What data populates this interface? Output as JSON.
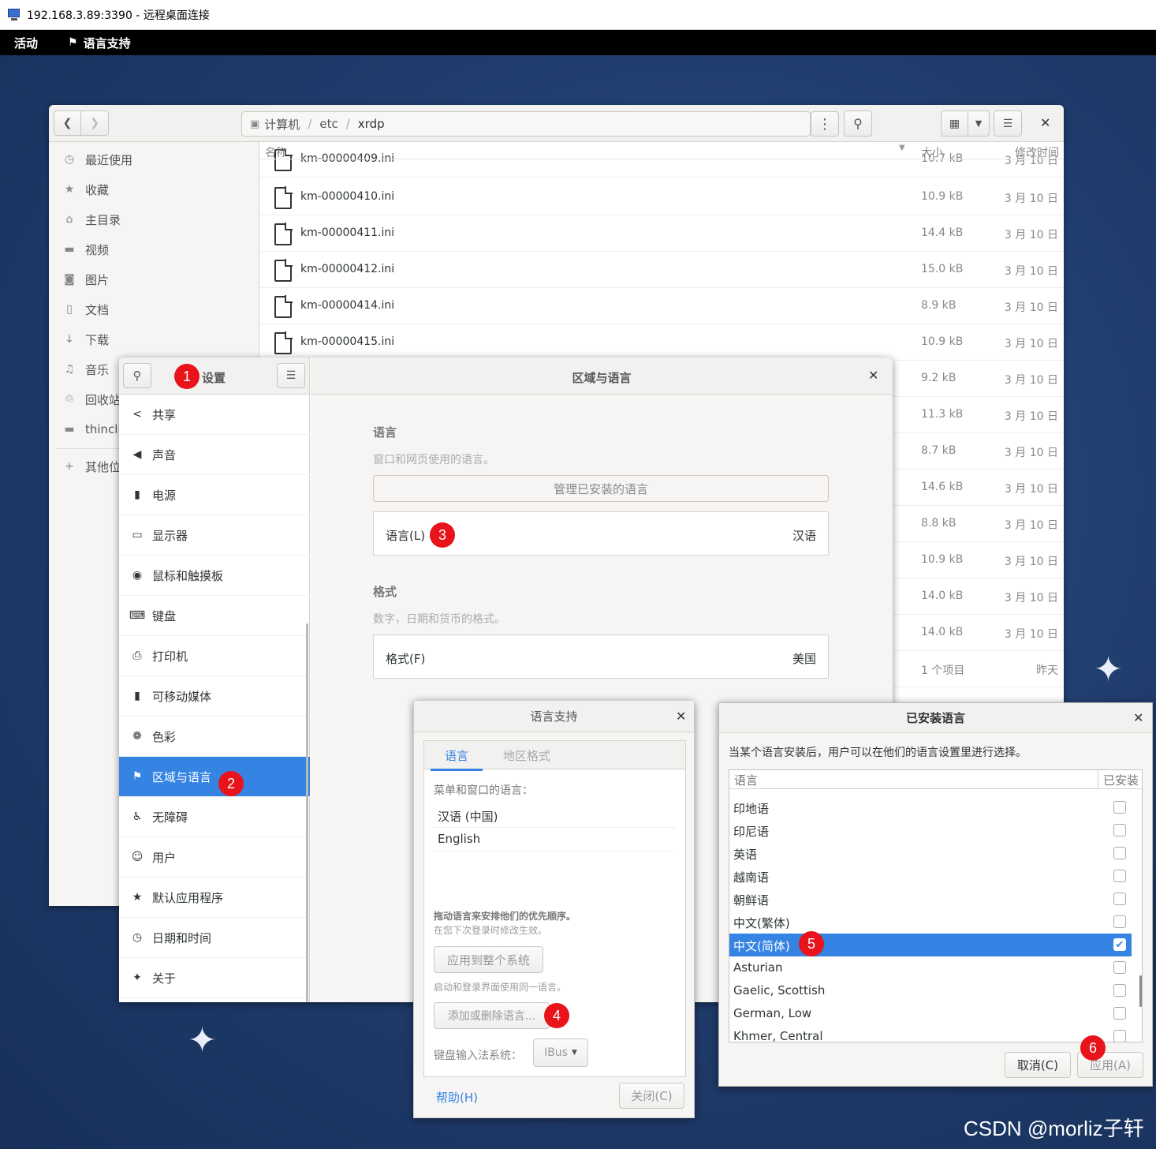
{
  "rdp": {
    "title": "192.168.3.89:3390 - 远程桌面连接"
  },
  "topbar": {
    "activities": "活动",
    "app_name": "语言支持"
  },
  "file_manager": {
    "path": [
      "计算机",
      "etc",
      "xrdp"
    ],
    "sidebar": [
      "最近使用",
      "收藏",
      "主目录",
      "视频",
      "图片",
      "文档",
      "下载",
      "音乐",
      "回收站",
      "thinclie",
      "其他位置"
    ],
    "columns": {
      "name": "名称",
      "size": "大小",
      "modified": "修改时间"
    },
    "rows": [
      {
        "name": "km-00000409.ini",
        "size": "10.7 kB",
        "date": "3 月 10 日"
      },
      {
        "name": "km-00000410.ini",
        "size": "10.9 kB",
        "date": "3 月 10 日"
      },
      {
        "name": "km-00000411.ini",
        "size": "14.4 kB",
        "date": "3 月 10 日"
      },
      {
        "name": "km-00000412.ini",
        "size": "15.0 kB",
        "date": "3 月 10 日"
      },
      {
        "name": "km-00000414.ini",
        "size": "8.9 kB",
        "date": "3 月 10 日"
      },
      {
        "name": "km-00000415.ini",
        "size": "10.9 kB",
        "date": "3 月 10 日"
      },
      {
        "name": "",
        "size": "9.2 kB",
        "date": "3 月 10 日"
      },
      {
        "name": "",
        "size": "11.3 kB",
        "date": "3 月 10 日"
      },
      {
        "name": "",
        "size": "8.7 kB",
        "date": "3 月 10 日"
      },
      {
        "name": "",
        "size": "14.6 kB",
        "date": "3 月 10 日"
      },
      {
        "name": "",
        "size": "8.8 kB",
        "date": "3 月 10 日"
      },
      {
        "name": "",
        "size": "10.9 kB",
        "date": "3 月 10 日"
      },
      {
        "name": "",
        "size": "14.0 kB",
        "date": "3 月 10 日"
      },
      {
        "name": "",
        "size": "14.0 kB",
        "date": "3 月 10 日"
      },
      {
        "name": "",
        "size": "1 个项目",
        "date": "昨天"
      }
    ]
  },
  "settings": {
    "title": "设置",
    "panel_title": "区域与语言",
    "items": [
      "共享",
      "声音",
      "电源",
      "显示器",
      "鼠标和触摸板",
      "键盘",
      "打印机",
      "可移动媒体",
      "色彩",
      "区域与语言",
      "无障碍",
      "用户",
      "默认应用程序",
      "日期和时间",
      "关于"
    ],
    "selected_index": 9,
    "language_header": "语言",
    "language_desc": "窗口和网页使用的语言。",
    "manage_button": "管理已安装的语言",
    "language_label": "语言(L)",
    "language_value": "汉语",
    "format_header": "格式",
    "format_desc": "数字，日期和货币的格式。",
    "format_label": "格式(F)",
    "format_value": "美国"
  },
  "language_support": {
    "title": "语言支持",
    "tabs": [
      "语言",
      "地区格式"
    ],
    "menu_lang_label": "菜单和窗口的语言：",
    "languages": [
      "汉语 (中国)",
      "English"
    ],
    "drag_hint": "拖动语言来安排他们的优先顺序。",
    "drag_sub": "在您下次登录时修改生效。",
    "apply_system": "应用到整个系统",
    "login_hint": "启动和登录界面使用同一语言。",
    "add_remove": "添加或删除语言...",
    "input_label": "键盘输入法系统：",
    "input_value": "IBus",
    "help": "帮助(H)",
    "close": "关闭(C)"
  },
  "installed_languages": {
    "title": "已安装语言",
    "desc": "当某个语言安装后，用户可以在他们的语言设置里进行选择。",
    "col_lang": "语言",
    "col_installed": "已安装",
    "rows": [
      {
        "name": "印地语",
        "installed": false
      },
      {
        "name": "印尼语",
        "installed": false
      },
      {
        "name": "英语",
        "installed": false
      },
      {
        "name": "越南语",
        "installed": false
      },
      {
        "name": "朝鲜语",
        "installed": false
      },
      {
        "name": "中文(繁体)",
        "installed": false
      },
      {
        "name": "中文(简体)",
        "installed": true
      },
      {
        "name": "Asturian",
        "installed": false
      },
      {
        "name": "Gaelic, Scottish",
        "installed": false
      },
      {
        "name": "German, Low",
        "installed": false
      },
      {
        "name": "Khmer, Central",
        "installed": false
      }
    ],
    "selected_index": 6,
    "cancel": "取消(C)",
    "apply": "应用(A)"
  },
  "annotations": [
    "1",
    "2",
    "3",
    "4",
    "5",
    "6"
  ],
  "watermark": "CSDN @morliz子轩",
  "colors": {
    "accent": "#3584e4",
    "badge": "#e8131b",
    "desktop": "#1f3b6b",
    "topbar": "#000000"
  }
}
